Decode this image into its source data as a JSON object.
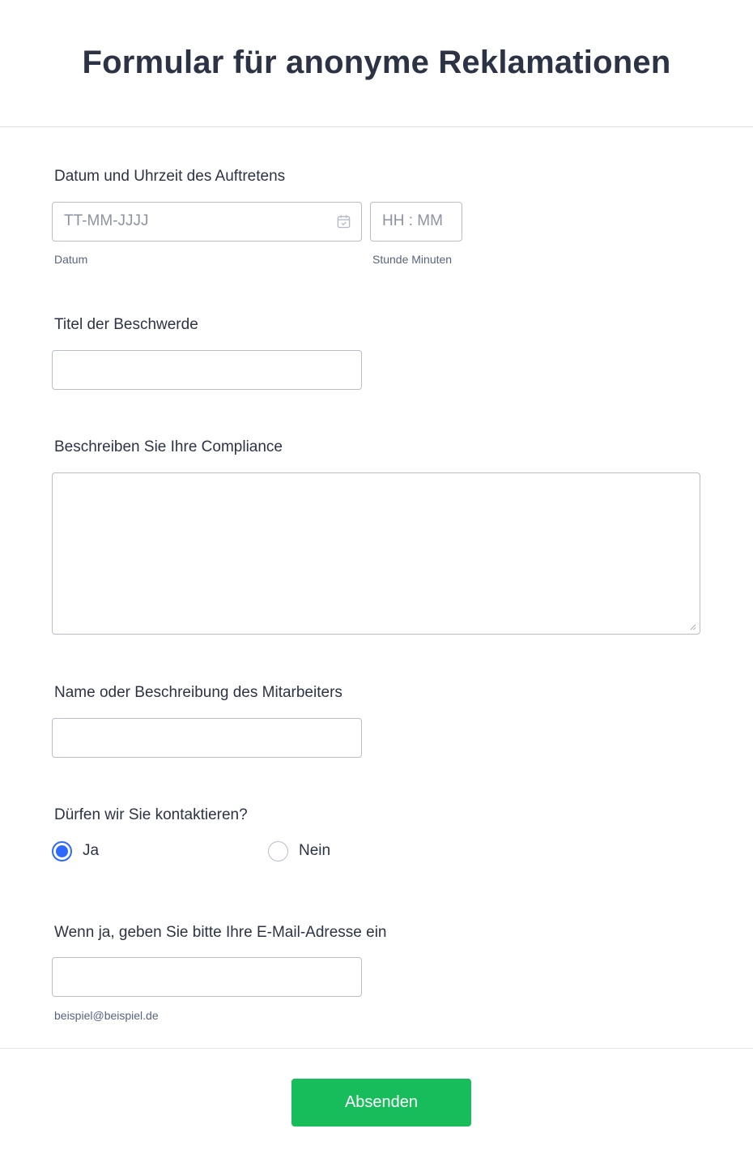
{
  "form": {
    "title": "Formular für anonyme Reklamationen"
  },
  "date_time": {
    "label": "Datum und Uhrzeit des Auftretens",
    "date_placeholder": "TT-MM-JJJJ",
    "date_sublabel": "Datum",
    "time_placeholder": "HH : MM",
    "time_sublabel": "Stunde Minuten",
    "date_icon": "calendar-icon"
  },
  "complaint_title": {
    "label": "Titel der Beschwerde",
    "value": ""
  },
  "compliance": {
    "label": "Beschreiben Sie Ihre Compliance",
    "value": ""
  },
  "employee": {
    "label": "Name oder Beschreibung des Mitarbeiters",
    "value": ""
  },
  "contact": {
    "label": "Dürfen wir Sie kontaktieren?",
    "options": [
      {
        "label": "Ja",
        "checked": true
      },
      {
        "label": "Nein",
        "checked": false
      }
    ]
  },
  "email": {
    "label": "Wenn ja, geben Sie bitte Ihre E-Mail-Adresse ein",
    "value": "",
    "sublabel": "beispiel@beispiel.de"
  },
  "submit": {
    "label": "Absenden",
    "color": "#18bd5b"
  },
  "colors": {
    "text": "#2c3345",
    "radio_selected": "#2e69ff",
    "border": "#b8bdc9"
  }
}
